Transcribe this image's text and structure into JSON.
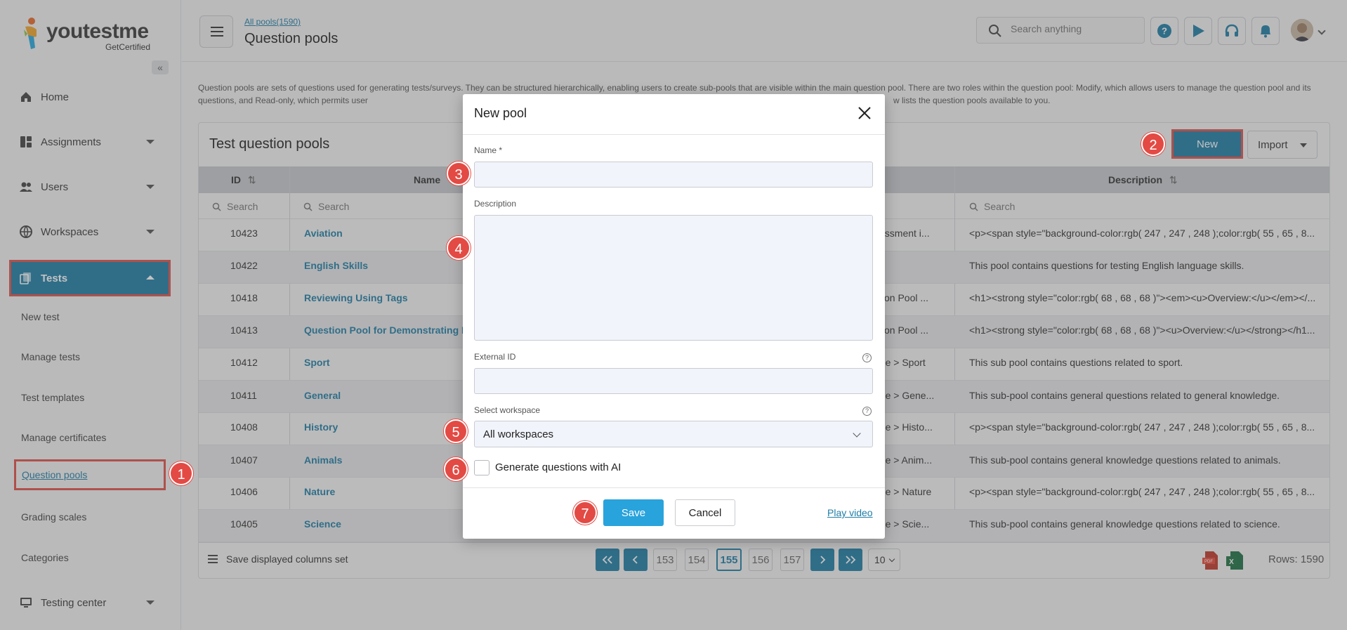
{
  "brand": {
    "name": "youtestme",
    "sub": "GetCertified"
  },
  "sidebar": {
    "collapse_icon": "«",
    "items": [
      {
        "label": "Home",
        "icon": "home-icon"
      },
      {
        "label": "Assignments",
        "icon": "assignments-icon"
      },
      {
        "label": "Users",
        "icon": "users-icon"
      },
      {
        "label": "Workspaces",
        "icon": "globe-icon"
      },
      {
        "label": "Tests",
        "icon": "tests-icon"
      },
      {
        "label": "Testing center",
        "icon": "testing-center-icon"
      }
    ],
    "sub_items": [
      "New test",
      "Manage tests",
      "Test templates",
      "Manage certificates",
      "Question pools",
      "Grading scales",
      "Categories"
    ]
  },
  "header": {
    "breadcrumb": "All pools(1590)",
    "title": "Question pools",
    "search_placeholder": "Search anything",
    "help_icon": "?"
  },
  "intro": "Question pools are sets of questions used for generating tests/surveys. They can be structured hierarchically, enabling users to create sub-pools that are visible within the main question pool. There are two roles within the question pool: Modify, which allows users to manage the question pool and its questions, and Read-only, which permits user",
  "intro_tail": "w lists the question pools available to you.",
  "card": {
    "title": "Test question pools",
    "new_label": "New",
    "import_label": "Import"
  },
  "table": {
    "headers": {
      "id": "ID",
      "name": "Name",
      "description": "Description",
      "sort_icon": "⇅"
    },
    "filter_placeholder": "Search",
    "rows": [
      {
        "id": "10423",
        "name": "Aviation",
        "mid": "sessment i...",
        "desc": "<p><span style=\"background-color:rgb( 247 , 247 , 248 );color:rgb( 55 , 65 , 8..."
      },
      {
        "id": "10422",
        "name": "English Skills",
        "mid": "",
        "desc": "This pool contains questions for testing English language skills."
      },
      {
        "id": "10418",
        "name": "Reviewing Using Tags",
        "mid": "stion Pool ...",
        "desc": "<h1><strong style=\"color:rgb( 68 , 68 , 68 )\"><em><u>Overview:</u></em></..."
      },
      {
        "id": "10413",
        "name": "Question Pool for Demonstrating Re",
        "mid": "stion Pool ...",
        "desc": "<h1><strong style=\"color:rgb( 68 , 68 , 68 )\"><u>Overview:</u></strong></h1..."
      },
      {
        "id": "10412",
        "name": "Sport",
        "mid": "dge > Sport",
        "desc": "This sub pool contains questions related to sport."
      },
      {
        "id": "10411",
        "name": "General",
        "mid": "dge > Gene...",
        "desc": "This sub-pool contains general questions related to general knowledge."
      },
      {
        "id": "10408",
        "name": "History",
        "mid": "dge > Histo...",
        "desc": "<p><span style=\"background-color:rgb( 247 , 247 , 248 );color:rgb( 55 , 65 , 8..."
      },
      {
        "id": "10407",
        "name": "Animals",
        "mid": "dge > Anim...",
        "desc": "This sub-pool contains general knowledge questions related to animals."
      },
      {
        "id": "10406",
        "name": "Nature",
        "mid": "dge > Nature",
        "desc": "<p><span style=\"background-color:rgb( 247 , 247 , 248 );color:rgb( 55 , 65 , 8..."
      },
      {
        "id": "10405",
        "name": "Science",
        "mid": "dge > Scie...",
        "desc": "This sub-pool contains general knowledge questions related to science."
      }
    ]
  },
  "footer": {
    "save_columns": "Save displayed columns set",
    "pages": [
      "153",
      "154",
      "155",
      "156",
      "157"
    ],
    "current_page": "155",
    "per_page": "10",
    "rows": "Rows: 1590"
  },
  "modal": {
    "title": "New pool",
    "name_label": "Name *",
    "description_label": "Description",
    "external_id_label": "External ID",
    "workspace_label": "Select workspace",
    "workspace_value": "All workspaces",
    "ai_label": "Generate questions with AI",
    "save_label": "Save",
    "cancel_label": "Cancel",
    "play_video_label": "Play video",
    "name_value": "",
    "description_value": "",
    "external_id_value": ""
  },
  "markers": [
    "1",
    "2",
    "3",
    "4",
    "5",
    "6",
    "7"
  ],
  "colors": {
    "primary": "#1f7ea6",
    "highlight": "#e0524a",
    "save": "#29a3dc",
    "marker": "#e34a44"
  }
}
